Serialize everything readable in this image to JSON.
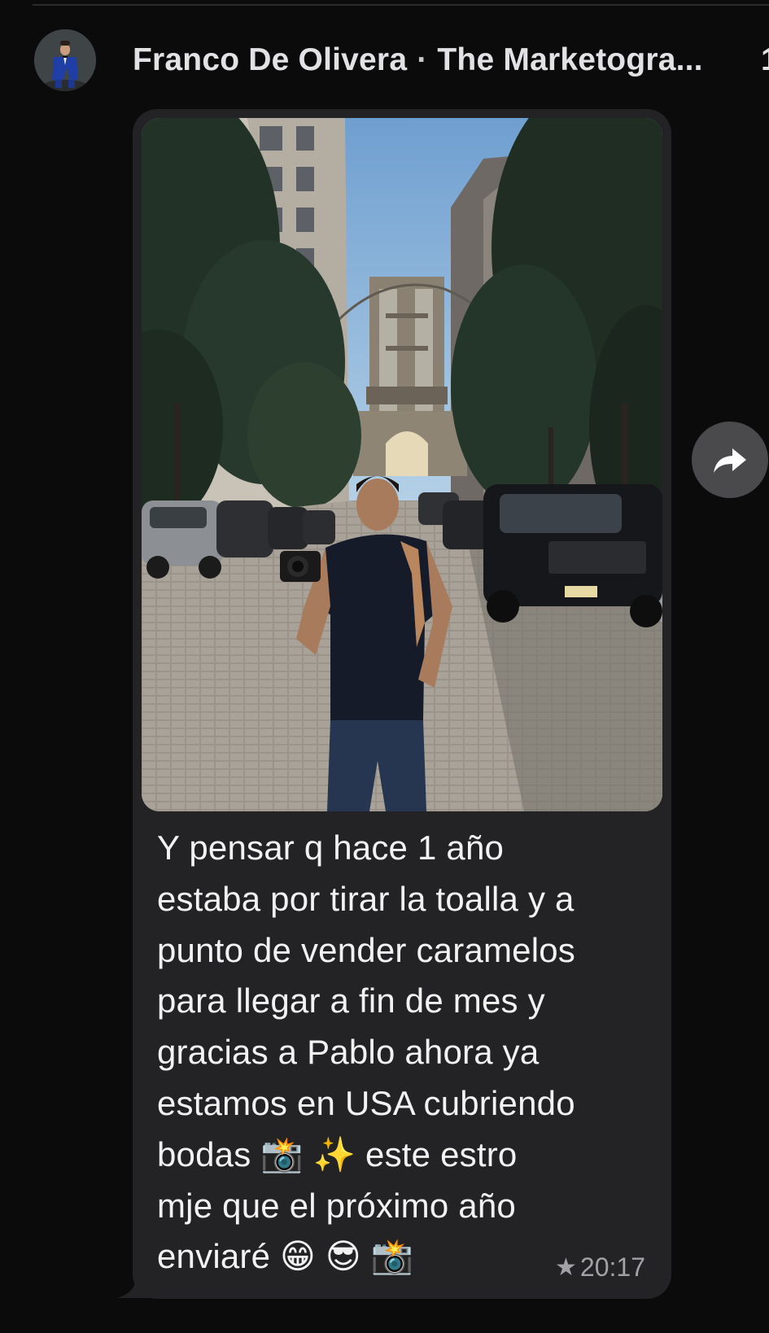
{
  "sender": {
    "name": "Franco De Olivera",
    "separator": "·",
    "group": "The Marketogra...",
    "truncated_extra": "1"
  },
  "message": {
    "lines": [
      "Y pensar q hace 1 año",
      "estaba por tirar la toalla y a",
      "punto de vender caramelos",
      "para llegar a fin de mes y",
      "gracias a Pablo ahora ya",
      "estamos en USA cubriendo",
      "bodas 📸 ✨  este estro",
      "mje que el próximo año",
      "enviaré 😁 😎 📸"
    ],
    "time": "20:17",
    "star_glyph": "★"
  },
  "icons": {
    "forward": "forward-arrow-icon",
    "star": "star-icon",
    "avatar": "profile-avatar"
  },
  "colors": {
    "background": "#0b0b0c",
    "bubble": "#232325",
    "text": "#f2f2f3",
    "meta": "#a2a2a6",
    "forward_button": "#4a4a4d"
  }
}
